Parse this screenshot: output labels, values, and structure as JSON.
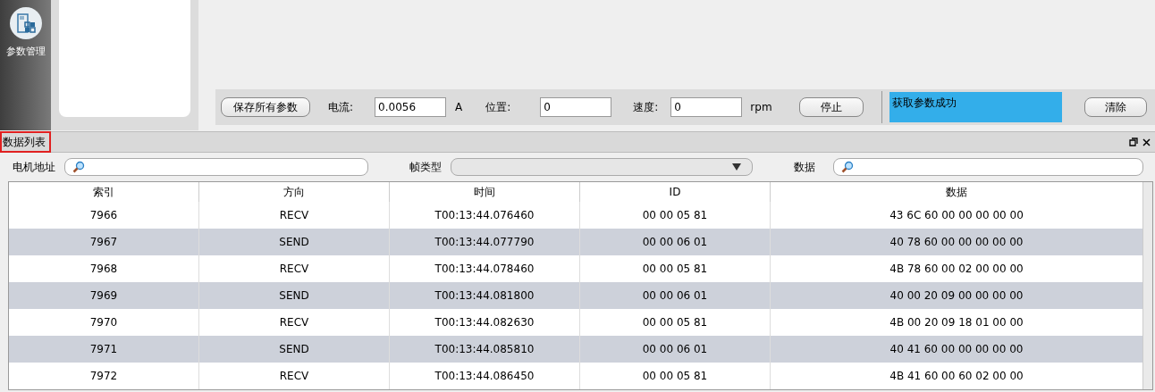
{
  "sidebar": {
    "items": [
      {
        "label": "参数管理"
      }
    ]
  },
  "control_bar": {
    "save_button": "保存所有参数",
    "current": {
      "label": "电流:",
      "value": "0.0056",
      "unit": "A"
    },
    "position": {
      "label": "位置:",
      "value": "0"
    },
    "speed": {
      "label": "速度:",
      "value": "0",
      "unit": "rpm"
    },
    "stop_button": "停止",
    "status": "获取参数成功",
    "clear_button": "清除"
  },
  "panel": {
    "title": "数据列表",
    "title_highlighted": true
  },
  "filters": {
    "motor_address": {
      "label": "电机地址"
    },
    "frame_type": {
      "label": "帧类型"
    },
    "data": {
      "label": "数据"
    }
  },
  "table": {
    "columns": [
      "索引",
      "方向",
      "时间",
      "ID",
      "数据"
    ],
    "rows": [
      [
        "7966",
        "RECV",
        "T00:13:44.076460",
        "00 00 05 81",
        "43 6C 60 00 00 00 00 00"
      ],
      [
        "7967",
        "SEND",
        "T00:13:44.077790",
        "00 00 06 01",
        "40 78 60 00 00 00 00 00"
      ],
      [
        "7968",
        "RECV",
        "T00:13:44.078460",
        "00 00 05 81",
        "4B 78 60 00 02 00 00 00"
      ],
      [
        "7969",
        "SEND",
        "T00:13:44.081800",
        "00 00 06 01",
        "40 00 20 09 00 00 00 00"
      ],
      [
        "7970",
        "RECV",
        "T00:13:44.082630",
        "00 00 05 81",
        "4B 00 20 09 18 01 00 00"
      ],
      [
        "7971",
        "SEND",
        "T00:13:44.085810",
        "00 00 06 01",
        "40 41 60 00 00 00 00 00"
      ],
      [
        "7972",
        "RECV",
        "T00:13:44.086450",
        "00 00 05 81",
        "4B 41 60 00 60 02 00 00"
      ]
    ]
  }
}
